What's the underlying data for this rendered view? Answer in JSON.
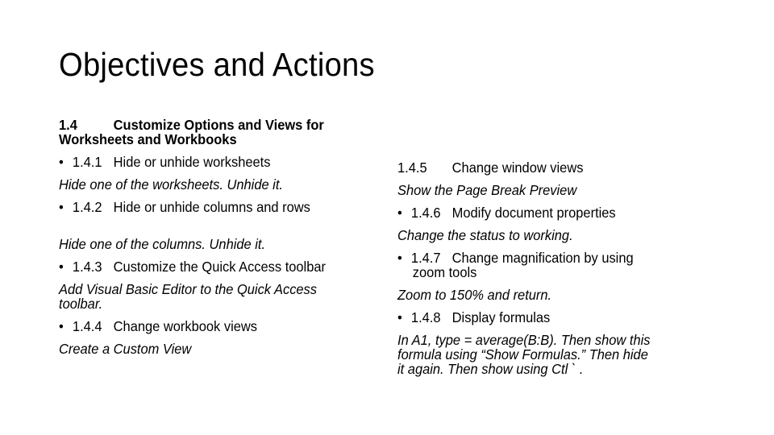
{
  "title": "Objectives and Actions",
  "left": {
    "heading": {
      "number": "1.4",
      "text_line1": "Customize Options and Views for",
      "text_line2": "Worksheets and Workbooks"
    },
    "items": [
      {
        "bullet": "•",
        "number": "1.4.1",
        "label": "Hide or unhide worksheets",
        "action": "Hide one of the worksheets.  Unhide it."
      },
      {
        "bullet": "•",
        "number": "1.4.2",
        "label": "Hide or unhide columns and rows",
        "action": "Hide one of the columns.  Unhide it."
      },
      {
        "bullet": "•",
        "number": "1.4.3",
        "label": "Customize the Quick Access toolbar",
        "action_line1": "Add Visual Basic Editor to the Quick Access",
        "action_line2": "toolbar."
      },
      {
        "bullet": "•",
        "number": "1.4.4",
        "label": "Change workbook views",
        "action": "Create a Custom View"
      }
    ]
  },
  "right": {
    "items": [
      {
        "number": "1.4.5",
        "label": "Change window views",
        "action": "Show the Page Break Preview"
      },
      {
        "bullet": "•",
        "number": "1.4.6",
        "label": "Modify document properties",
        "action": "Change the status to working."
      },
      {
        "bullet": "•",
        "number": "1.4.7",
        "label_line1": "Change magnification by using",
        "label_line2": "zoom tools",
        "action": "Zoom to 150% and return."
      },
      {
        "bullet": "•",
        "number": "1.4.8",
        "label": "Display formulas",
        "action_line1": "In A1, type = average(B:B).  Then show this",
        "action_line2": "formula using “Show Formulas.”  Then hide",
        "action_line3": "it again.  Then show using Ctl ` ."
      }
    ]
  }
}
